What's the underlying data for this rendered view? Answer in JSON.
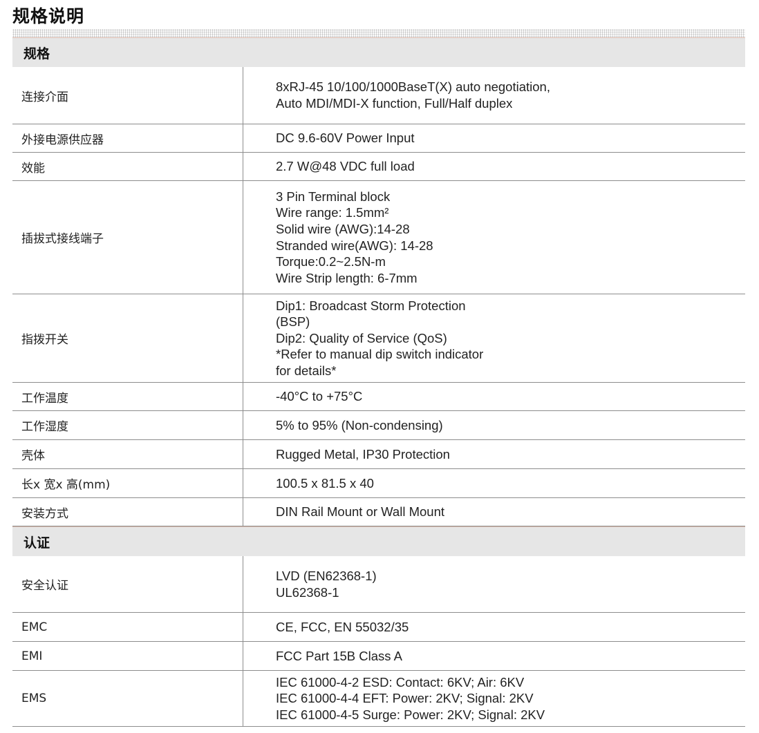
{
  "page": {
    "title": "规格说明"
  },
  "sections": [
    {
      "heading": "规格",
      "rows": [
        {
          "label": "连接介面",
          "lines": [
            "8xRJ-45 10/100/1000BaseT(X) auto negotiation,",
            "Auto MDI/MDI-X function, Full/Half duplex"
          ]
        },
        {
          "label": "外接电源供应器",
          "lines": [
            "DC 9.6-60V Power Input"
          ]
        },
        {
          "label": "效能",
          "lines": [
            "2.7 W@48 VDC full load"
          ]
        },
        {
          "label": "插拔式接线端子",
          "lines": [
            "3 Pin Terminal block",
            "Wire range: 1.5mm²",
            "Solid wire (AWG):14-28",
            "Stranded wire(AWG): 14-28",
            "Torque:0.2~2.5N-m",
            "Wire Strip length: 6-7mm"
          ]
        },
        {
          "label": "指拨开关",
          "lines": [
            "Dip1: Broadcast Storm Protection",
            "(BSP)",
            "Dip2: Quality of Service (QoS)",
            "*Refer to manual dip switch indicator",
            "for details*"
          ]
        },
        {
          "label": "工作温度",
          "lines": [
            "-40°C to +75°C"
          ]
        },
        {
          "label": "工作湿度",
          "lines": [
            "5% to 95% (Non-condensing)"
          ]
        },
        {
          "label": "壳体",
          "lines": [
            "Rugged Metal, IP30 Protection"
          ]
        },
        {
          "label": "长x 宽x 高(mm)",
          "lines": [
            "100.5 x 81.5 x 40"
          ]
        },
        {
          "label": "安装方式",
          "lines": [
            "DIN Rail Mount or Wall Mount"
          ]
        }
      ]
    },
    {
      "heading": "认证",
      "rows": [
        {
          "label": "安全认证",
          "lines": [
            "LVD (EN62368-1)",
            "UL62368-1"
          ]
        },
        {
          "label": "EMC",
          "lines": [
            "CE, FCC, EN 55032/35"
          ]
        },
        {
          "label": "EMI",
          "lines": [
            "FCC Part 15B Class A"
          ]
        },
        {
          "label": "EMS",
          "lines": [
            "IEC 61000-4-2 ESD: Contact: 6KV; Air: 6KV",
            "IEC 61000-4-4 EFT: Power: 2KV; Signal: 2KV",
            "IEC 61000-4-5 Surge: Power: 2KV; Signal: 2KV"
          ]
        }
      ]
    }
  ]
}
